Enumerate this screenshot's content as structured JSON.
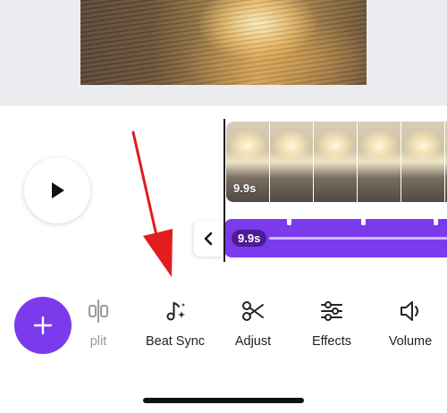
{
  "preview": {},
  "timeline": {
    "video_duration": "9.9s",
    "audio_duration": "9.9s"
  },
  "toolbar": {
    "items": [
      {
        "label": "Split",
        "visible_text": "plit",
        "icon": "split-icon"
      },
      {
        "label": "Beat Sync",
        "icon": "beat-sync-icon"
      },
      {
        "label": "Adjust",
        "icon": "scissors-icon"
      },
      {
        "label": "Effects",
        "icon": "sliders-icon"
      },
      {
        "label": "Volume",
        "icon": "volume-icon"
      }
    ]
  },
  "colors": {
    "accent": "#7c3aed",
    "audio_badge": "#4c1d95",
    "annotation_arrow": "#e11d1d",
    "preview_background": "#ebecf0"
  }
}
